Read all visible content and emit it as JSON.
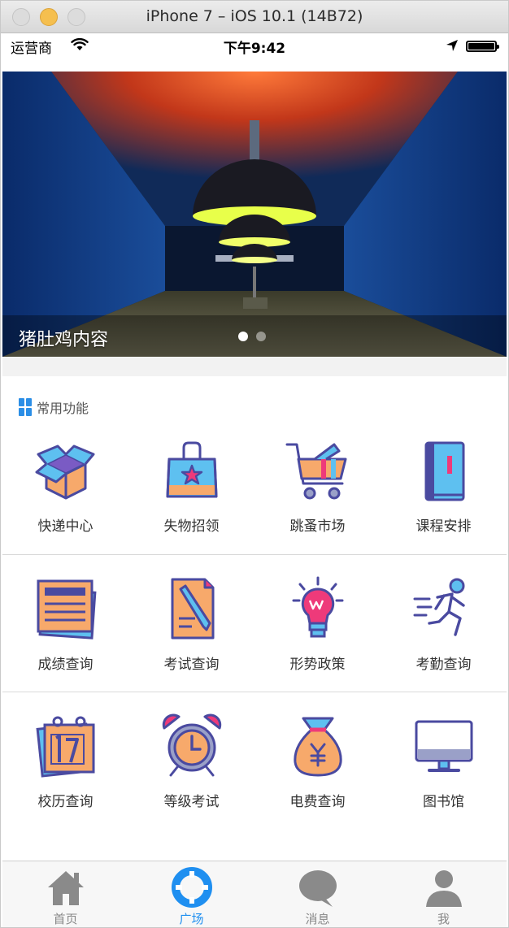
{
  "window": {
    "title": "iPhone 7 – iOS 10.1 (14B72)"
  },
  "status_bar": {
    "carrier": "运营商",
    "time": "下午9:42"
  },
  "banner": {
    "caption": "猪肚鸡内容",
    "page_count": 2,
    "current_page": 1
  },
  "section": {
    "title": "常用功能"
  },
  "features": [
    {
      "label": "快递中心",
      "icon": "package-box-icon"
    },
    {
      "label": "失物招领",
      "icon": "shopping-bag-icon"
    },
    {
      "label": "跳蚤市场",
      "icon": "shopping-cart-icon"
    },
    {
      "label": "课程安排",
      "icon": "book-icon"
    },
    {
      "label": "成绩查询",
      "icon": "report-sheet-icon"
    },
    {
      "label": "考试查询",
      "icon": "exam-paper-pen-icon"
    },
    {
      "label": "形势政策",
      "icon": "lightbulb-icon"
    },
    {
      "label": "考勤查询",
      "icon": "running-person-icon"
    },
    {
      "label": "校历查询",
      "icon": "calendar-icon"
    },
    {
      "label": "等级考试",
      "icon": "alarm-clock-icon"
    },
    {
      "label": "电费查询",
      "icon": "money-bag-icon"
    },
    {
      "label": "图书馆",
      "icon": "monitor-icon"
    }
  ],
  "tabs": [
    {
      "label": "首页",
      "icon": "home-icon",
      "active": false
    },
    {
      "label": "广场",
      "icon": "lifebuoy-icon",
      "active": true
    },
    {
      "label": "消息",
      "icon": "chat-bubble-icon",
      "active": false
    },
    {
      "label": "我",
      "icon": "user-icon",
      "active": false
    }
  ],
  "colors": {
    "accent": "#1f8ff0",
    "icon_outline": "#4a4aa0",
    "icon_orange": "#f7a96b",
    "icon_blue": "#5ec0f0",
    "icon_pink": "#ee3a7a",
    "tab_inactive": "#888888"
  }
}
